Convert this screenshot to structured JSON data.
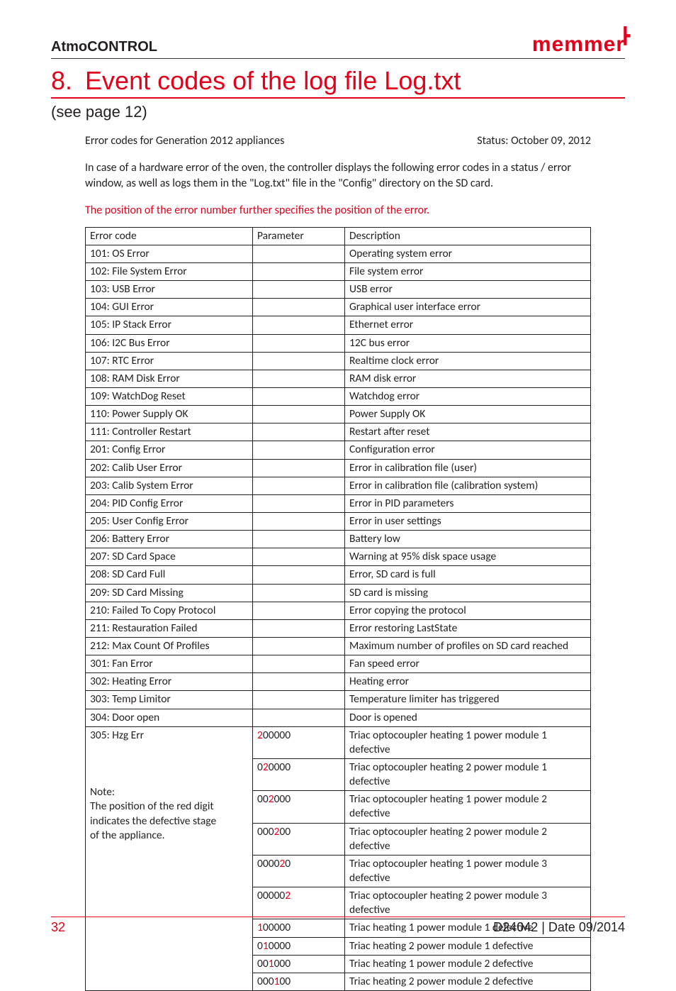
{
  "header": {
    "doc_title": "AtmoCONTROL",
    "brand": "memmer"
  },
  "heading": {
    "num": "8.",
    "text": "Event codes of the log file Log.txt"
  },
  "subheading": "(see page 12)",
  "meta": {
    "left": "Error codes for Generation 2012 appliances",
    "right": "Status: October 09, 2012"
  },
  "intro": "In case of a hardware error of the oven, the controller displays the following error codes in a status / error window, as well as logs them in the \"Log.txt\" file in the \"Config\" directory on the SD card.",
  "red_note": "The position of the error number further specifies the position of the error.",
  "table": {
    "head": {
      "code": "Error code",
      "param": "Parameter",
      "desc": "Description"
    },
    "simple_rows": [
      {
        "code": "101: OS Error",
        "desc": "Operating system error"
      },
      {
        "code": "102: File System Error",
        "desc": "File system error"
      },
      {
        "code": "103: USB Error",
        "desc": "USB error"
      },
      {
        "code": "104: GUI Error",
        "desc": "Graphical user interface error"
      },
      {
        "code": "105: IP Stack Error",
        "desc": "Ethernet error"
      },
      {
        "code": "106: I2C Bus Error",
        "desc": "12C bus error"
      },
      {
        "code": "107: RTC Error",
        "desc": "Realtime clock error"
      },
      {
        "code": "108: RAM Disk Error",
        "desc": "RAM disk error"
      },
      {
        "code": "109: WatchDog Reset",
        "desc": "Watchdog error"
      },
      {
        "code": "110: Power Supply OK",
        "desc": "Power Supply OK"
      },
      {
        "code": "111: Controller Restart",
        "desc": "Restart after reset"
      },
      {
        "code": "201: Config Error",
        "desc": "Configuration error"
      },
      {
        "code": "202: Calib User Error",
        "desc": "Error in calibration file (user)"
      },
      {
        "code": "203: Calib System Error",
        "desc": "Error in calibration file (calibration system)"
      },
      {
        "code": "204: PID Config Error",
        "desc": "Error in PID parameters"
      },
      {
        "code": "205: User Config Error",
        "desc": "Error in user settings"
      },
      {
        "code": "206: Battery Error",
        "desc": "Battery low"
      },
      {
        "code": "207: SD Card Space",
        "desc": "Warning at 95% disk space usage"
      },
      {
        "code": "208: SD Card Full",
        "desc": "Error, SD card is full"
      },
      {
        "code": "209: SD Card Missing",
        "desc": "SD card is missing"
      },
      {
        "code": "210: Failed To Copy Protocol",
        "desc": "Error copying the protocol"
      },
      {
        "code": "211: Restauration Failed",
        "desc": "Error restoring LastState"
      },
      {
        "code": "212: Max Count Of Profiles",
        "desc": "Maximum number of profiles on SD card reached"
      },
      {
        "code": "301: Fan Error",
        "desc": "Fan speed error"
      },
      {
        "code": "302: Heating Error",
        "desc": "Heating error"
      },
      {
        "code": "303: Temp Limitor",
        "desc": "Temperature limiter has triggered"
      },
      {
        "code": "304: Door open",
        "desc": "Door is opened"
      }
    ],
    "hzg_label": "305: Hzg Err",
    "note_lines": [
      "Note:",
      "The position of the red digit",
      "indicates the defective stage",
      "of the appliance."
    ],
    "hzg_rows": [
      {
        "param_digits": "200000",
        "red_idx": 0,
        "desc": "Triac optocoupler heating 1 power module 1 defective"
      },
      {
        "param_digits": "020000",
        "red_idx": 1,
        "desc": "Triac optocoupler heating 2 power module 1 defective"
      },
      {
        "param_digits": "002000",
        "red_idx": 2,
        "desc": "Triac optocoupler heating 1 power module 2 defective"
      },
      {
        "param_digits": "000200",
        "red_idx": 3,
        "desc": "Triac optocoupler heating 2 power module 2 defective"
      },
      {
        "param_digits": "000020",
        "red_idx": 4,
        "desc": "Triac optocoupler heating 1 power module 3 defective"
      },
      {
        "param_digits": "000002",
        "red_idx": 5,
        "desc": "Triac optocoupler heating 2 power module 3 defective"
      },
      {
        "param_digits": "100000",
        "red_idx": 0,
        "desc": "Triac heating 1 power module 1 defective"
      },
      {
        "param_digits": "010000",
        "red_idx": 1,
        "desc": "Triac heating 2 power module 1 defective"
      },
      {
        "param_digits": "001000",
        "red_idx": 2,
        "desc": "Triac heating 1 power module 2 defective"
      },
      {
        "param_digits": "000100",
        "red_idx": 3,
        "desc": "Triac heating 2 power module 2 defective"
      }
    ]
  },
  "footer": {
    "page": "32",
    "right": "D24042 | Date 09/2014"
  }
}
